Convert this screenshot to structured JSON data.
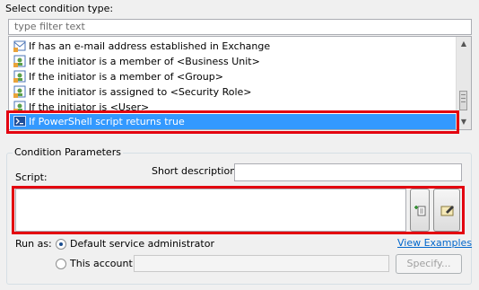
{
  "select_label": "Select condition type:",
  "filter": {
    "placeholder": "type filter text"
  },
  "conditions": [
    {
      "label": "If has an e-mail address established in Exchange",
      "icon": "mail-condition-icon",
      "selected": false
    },
    {
      "label": "If the initiator is a member of <Business Unit>",
      "icon": "user-condition-icon",
      "selected": false
    },
    {
      "label": "If the initiator is a member of <Group>",
      "icon": "user-condition-icon",
      "selected": false
    },
    {
      "label": "If the initiator is assigned to <Security Role>",
      "icon": "user-condition-icon",
      "selected": false
    },
    {
      "label": "If the initiator is <User>",
      "icon": "user-condition-icon",
      "selected": false
    },
    {
      "label": "If PowerShell script returns true",
      "icon": "powershell-icon",
      "selected": true
    }
  ],
  "params": {
    "title": "Condition Parameters",
    "script_label": "Script:",
    "short_desc_label": "Short description:",
    "run_as_label": "Run as:",
    "default_admin_label": "Default service administrator",
    "this_account_label": "This account:",
    "view_examples": "View Examples",
    "specify_button": "Specify..."
  },
  "colors": {
    "highlight": "#e3000f",
    "selection": "#3399ff"
  }
}
